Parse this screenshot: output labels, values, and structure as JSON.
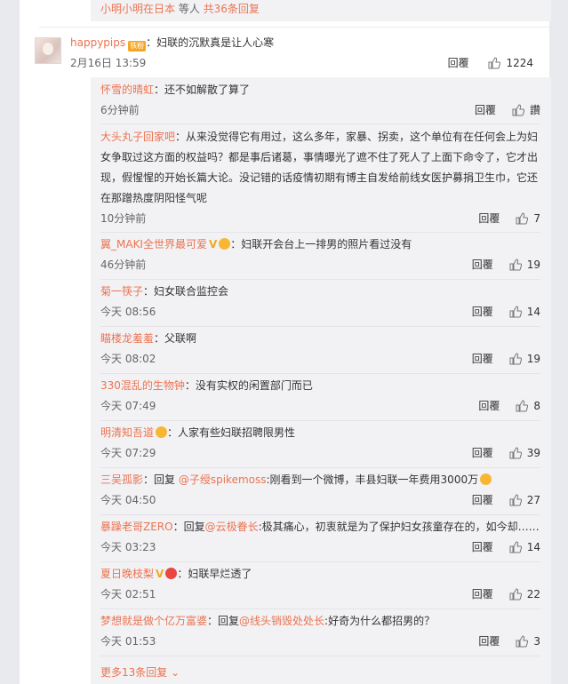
{
  "top_bar": {
    "user1": "小明小明在日本",
    "mid": " 等人 ",
    "count_link": "共36条回复"
  },
  "main_comment": {
    "username": "happypips",
    "badge": "铁粉",
    "text": "：妇联的沉默真是让人心寒",
    "time": "2月16日 13:59",
    "reply_label": "回覆",
    "likes": "1224"
  },
  "replies": [
    {
      "user": "怀雪的晴虹",
      "text": "：还不如解散了算了",
      "time": "6分钟前",
      "reply_label": "回覆",
      "likes": "讚"
    },
    {
      "user": "大头丸子回家吧",
      "text": "：从来没觉得它有用过，这么多年，家暴、拐卖，这个单位有在任何会上为妇女争取过这方面的权益吗？都是事后诸葛，事情曝光了遮不住了死人了上面下命令了，它才出现，假惺惺的开始长篇大论。没记错的话疫情初期有博主自发给前线女医护募捐卫生巾，它还在那蹭热度阴阳怪气呢",
      "time": "10分钟前",
      "reply_label": "回覆",
      "likes": "7"
    },
    {
      "user": "翼_MAKI全世界最可爱",
      "text": "：妇联开会台上一排男的照片看过没有",
      "time": "46分钟前",
      "reply_label": "回覆",
      "likes": "19"
    },
    {
      "user": "菊一筷子",
      "text": "：妇女联合监控会",
      "time": "今天 08:56",
      "reply_label": "回覆",
      "likes": "14"
    },
    {
      "user": "瞄楼龙羞羞",
      "text": "：父联啊",
      "time": "今天 08:02",
      "reply_label": "回覆",
      "likes": "19"
    },
    {
      "user": "330混乱的生物钟",
      "text": "：没有实权的闲置部门而已",
      "time": "今天 07:49",
      "reply_label": "回覆",
      "likes": "8"
    },
    {
      "user": "明清知吾道",
      "text": "：人家有些妇联招聘限男性",
      "time": "今天 07:29",
      "reply_label": "回覆",
      "likes": "39"
    },
    {
      "user": "三吴孤影",
      "pre": "：回复 ",
      "mention": "@子绶spikemoss",
      "text": ":刚看到一个微博，丰县妇联一年费用3000万",
      "time": "今天 04:50",
      "reply_label": "回覆",
      "likes": "27"
    },
    {
      "user": "暴躁老哥ZERO",
      "pre": "：回复",
      "mention": "@云极眷长",
      "text": ":极其痛心，初衷就是为了保护妇女孩童存在的，如今却……",
      "time": "今天 03:23",
      "reply_label": "回覆",
      "likes": "14"
    },
    {
      "user": "夏日晚枝梨",
      "text": "：妇联早烂透了",
      "time": "今天 02:51",
      "reply_label": "回覆",
      "likes": "22"
    },
    {
      "user": "梦想就是做个亿万富婆",
      "pre": "：回复",
      "mention": "@线头销毁处处长",
      "text": ":好奇为什么都招男的？",
      "time": "今天 01:53",
      "reply_label": "回覆",
      "likes": "3"
    }
  ],
  "more_link": "更多13条回复 ⌄",
  "colors": {
    "accent": "#eb7350",
    "subbox": "#f2f2f5"
  }
}
